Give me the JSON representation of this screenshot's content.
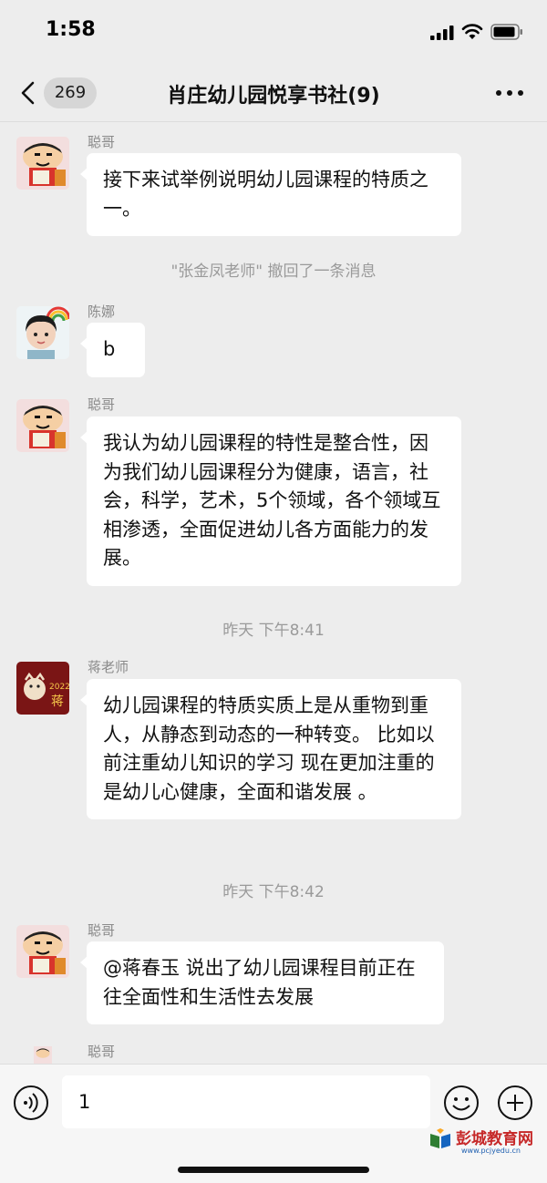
{
  "status_bar": {
    "time": "1:58"
  },
  "nav": {
    "unread_count": "269",
    "title": "肖庄幼儿园悦享书社(9)"
  },
  "messages": [
    {
      "sender": "聪哥",
      "text": "接下来试举例说明幼儿园课程的特质之一。"
    },
    {
      "system": "\"张金凤老师\" 撤回了一条消息"
    },
    {
      "sender": "陈娜",
      "text": "b"
    },
    {
      "sender": "聪哥",
      "text": "我认为幼儿园课程的特性是整合性，因为我们幼儿园课程分为健康，语言，社会，科学，艺术，5个领域，各个领域互相渗透，全面促进幼儿各方面能力的发展。"
    },
    {
      "timestamp": "昨天 下午8:41"
    },
    {
      "sender": "蒋老师",
      "text": "幼儿园课程的特质实质上是从重物到重人，从静态到动态的一种转变。 比如以前注重幼儿知识的学习 现在更加注重的是幼儿心健康，全面和谐发展 。"
    },
    {
      "timestamp": "昨天 下午8:42"
    },
    {
      "sender": "聪哥",
      "text": "@蒋春玉 说出了幼儿园课程目前正在往全面性和生活性去发展"
    },
    {
      "sender": "聪哥",
      "text": ""
    }
  ],
  "avatars": {
    "teacher_avatar_text": "蒋",
    "teacher_avatar_year": "2022"
  },
  "input": {
    "value": "1"
  },
  "watermark": {
    "name": "彭城教育网",
    "url": "www.pcjyedu.cn"
  },
  "colors": {
    "background": "#ededed",
    "bubble": "#ffffff",
    "watermark_red": "#c62828"
  }
}
